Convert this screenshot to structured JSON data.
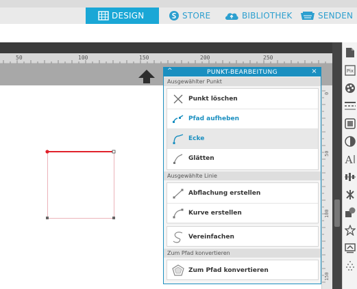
{
  "nav": {
    "tabs": [
      {
        "label": "DESIGN",
        "icon": "grid-icon",
        "active": true
      },
      {
        "label": "STORE",
        "icon": "store-icon"
      },
      {
        "label": "BIBLIOTHEK",
        "icon": "cloud-icon"
      },
      {
        "label": "SENDEN",
        "icon": "cutter-icon"
      }
    ],
    "active_color": "#1aa7d6",
    "text_color": "#2c9fcf"
  },
  "ruler": {
    "labels": [
      "50",
      "100",
      "150",
      "200",
      "250"
    ]
  },
  "vruler": {
    "labels": [
      "0",
      "50",
      "100",
      "150"
    ]
  },
  "panel": {
    "title": "PUNKT-BEARBEITUNG",
    "collapse_glyph": "^",
    "close_glyph": "×",
    "accent": "#1a8fc0",
    "sections": {
      "point": {
        "title": "Ausgewählter Punkt",
        "buttons": [
          {
            "label": "Punkt löschen",
            "icon": "delete-point-icon"
          },
          {
            "label": "Pfad aufheben",
            "icon": "break-path-icon",
            "active": true
          },
          {
            "label": "Ecke",
            "icon": "corner-icon",
            "active": true,
            "highlighted": true
          },
          {
            "label": "Glätten",
            "icon": "smooth-icon"
          }
        ]
      },
      "line": {
        "title": "Ausgewählte Linie",
        "buttons": [
          {
            "label": "Abflachung erstellen",
            "icon": "make-straight-icon"
          },
          {
            "label": "Kurve erstellen",
            "icon": "make-curve-icon"
          }
        ],
        "simplify": {
          "label": "Vereinfachen",
          "icon": "simplify-icon"
        }
      },
      "convert": {
        "title": "Zum Pfad konvertieren",
        "button": {
          "label": "Zum Pfad konvertieren",
          "icon": "convert-to-path-icon"
        }
      }
    }
  },
  "tools": [
    "page-icon",
    "pixscan-icon",
    "palette-icon",
    "line-style-icon",
    "image-effects-icon",
    "fill-icon",
    "text-icon",
    "align-icon",
    "replicate-icon",
    "modify-icon",
    "offset-icon",
    "trace-icon",
    "dots-icon"
  ]
}
